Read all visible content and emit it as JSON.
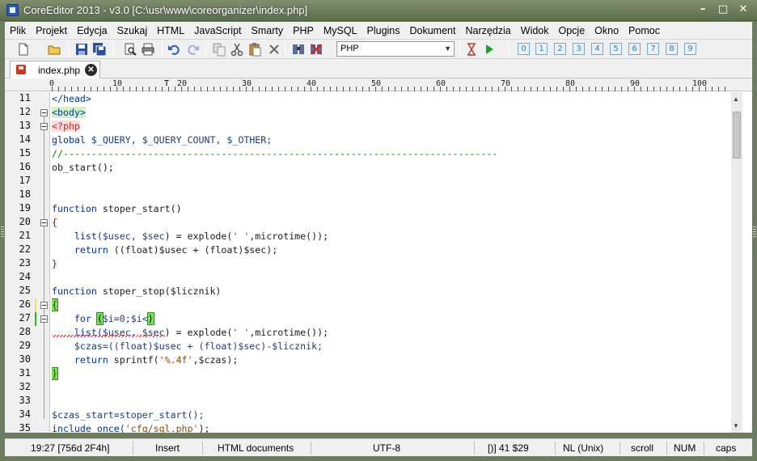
{
  "window": {
    "title": "CoreEditor 2013 - v3.0 [C:\\usr\\www\\coreorganizer\\index.php]",
    "minimize_glyph": "–",
    "maximize_glyph": "□",
    "close_glyph": "✕"
  },
  "menu": [
    "Plik",
    "Projekt",
    "Edycja",
    "Szukaj",
    "HTML",
    "JavaScript",
    "Smarty",
    "PHP",
    "MySQL",
    "Plugins",
    "Dokument",
    "Narzędzia",
    "Widok",
    "Opcje",
    "Okno",
    "Pomoc"
  ],
  "toolbar": {
    "language": "PHP",
    "number_buttons": [
      "0",
      "1",
      "2",
      "3",
      "4",
      "5",
      "6",
      "7",
      "8",
      "9"
    ],
    "icons": [
      "new-file-icon",
      "open-folder-icon",
      "save-icon",
      "save-all-icon",
      "print-preview-icon",
      "print-icon",
      "undo-icon",
      "redo-icon",
      "copy-icon",
      "cut-icon",
      "paste-icon",
      "delete-icon",
      "find-icon",
      "replace-icon",
      "hourglass-icon",
      "run-icon"
    ]
  },
  "tabs": [
    {
      "label": "index.php",
      "close_glyph": "✕"
    }
  ],
  "ruler": {
    "marks": [
      "0",
      "10",
      "20",
      "30",
      "40",
      "50",
      "60",
      "70",
      "80",
      "90",
      "100"
    ],
    "caret_glyph": "T"
  },
  "line_numbers": [
    "11",
    "12",
    "13",
    "14",
    "15",
    "16",
    "17",
    "18",
    "19",
    "20",
    "21",
    "22",
    "23",
    "24",
    "25",
    "26",
    "27",
    "28",
    "29",
    "30",
    "31",
    "32",
    "33",
    "34",
    "35"
  ],
  "code": {
    "l11": "</head>",
    "l12": "<body>",
    "l13": "<?php",
    "l14a": "global ",
    "l14b": "$_QUERY, $_QUERY_COUNT, $_OTHER;",
    "l15": "//-----------------------------------------------------------------------------",
    "l16": "ob_start();",
    "l19a": "function ",
    "l19b": "stoper_start()",
    "l20": "{",
    "l21a": "    list(",
    "l21b": "$usec, $sec",
    "l21c": ") = explode(",
    "l21d": "' '",
    "l21e": ",microtime());",
    "l22a": "    return ",
    "l22b": "((float)$usec + (float)$sec);",
    "l23": "}",
    "l25a": "function ",
    "l25b": "stoper_stop($licznik)",
    "l26": "{",
    "l27a": "    for ",
    "l27b": "(",
    "l27c": "$i=0;$i<",
    "l27d": ")",
    "l28a": "    list(",
    "l28b": "$usec, $sec",
    "l28c": ") = explode(",
    "l28d": "' '",
    "l28e": ",microtime());",
    "l29": "    $czas=((float)$usec + (float)$sec)-$licznik;",
    "l30a": "    return ",
    "l30b": "sprintf(",
    "l30c": "'%.4f'",
    "l30d": ",$czas);",
    "l31": "}",
    "l34": "$czas_start=stoper_start();",
    "l35a": "include_once(",
    "l35b": "'cfg/sql.php'",
    "l35c": ");"
  },
  "status": {
    "position": "19:27 [756d 2F4h]",
    "mode": "Insert",
    "doc_type": "HTML documents",
    "encoding": "UTF-8",
    "selection": "[)] 41 $29",
    "line_ending": "NL (Unix)",
    "scroll": "scroll",
    "num": "NUM",
    "caps": "caps"
  },
  "colors": {
    "frame": "#6b7d5e",
    "keyword": "#002fa7",
    "comment": "#008000",
    "php_tag": "#c8262a",
    "bracket_highlight": "#7ce05c"
  }
}
